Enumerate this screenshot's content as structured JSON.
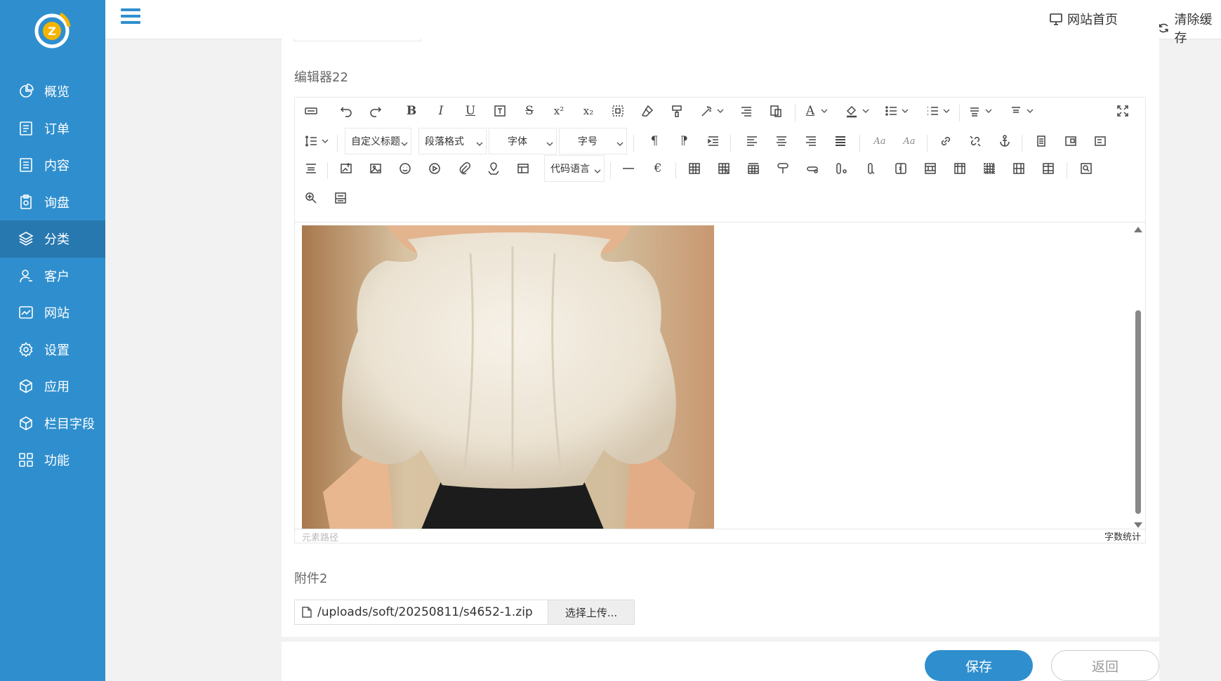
{
  "sidebar": {
    "logo_icon": "z-logo-icon",
    "items": [
      {
        "label": "概览",
        "icon": "pie-chart-icon"
      },
      {
        "label": "订单",
        "icon": "order-list-icon"
      },
      {
        "label": "内容",
        "icon": "document-icon"
      },
      {
        "label": "询盘",
        "icon": "clipboard-icon"
      },
      {
        "label": "分类",
        "icon": "layers-icon",
        "active": true
      },
      {
        "label": "客户",
        "icon": "user-icon"
      },
      {
        "label": "网站",
        "icon": "website-icon"
      },
      {
        "label": "设置",
        "icon": "gear-icon"
      },
      {
        "label": "应用",
        "icon": "cube-icon"
      },
      {
        "label": "栏目字段",
        "icon": "cube-icon"
      },
      {
        "label": "功能",
        "icon": "grid-icon"
      }
    ],
    "bg_color": "#2f8fce",
    "active_color": "#2878b0"
  },
  "topbar": {
    "menu_icon": "hamburger-icon",
    "home_link": "网站首页",
    "clear_cache": "清除缓存"
  },
  "editor": {
    "label": "编辑器22",
    "combos": {
      "custom_title": "自定义标题",
      "paragraph_format": "段落格式",
      "font_family": "字体",
      "font_size": "字号",
      "code_language": "代码语言"
    },
    "status_path": "元素路径",
    "word_count": "字数统计"
  },
  "attachment": {
    "label": "附件2",
    "file_path": "/uploads/soft/20250811/s4652-1.zip",
    "upload_button": "选择上传..."
  },
  "footer": {
    "save": "保存",
    "back": "返回"
  }
}
